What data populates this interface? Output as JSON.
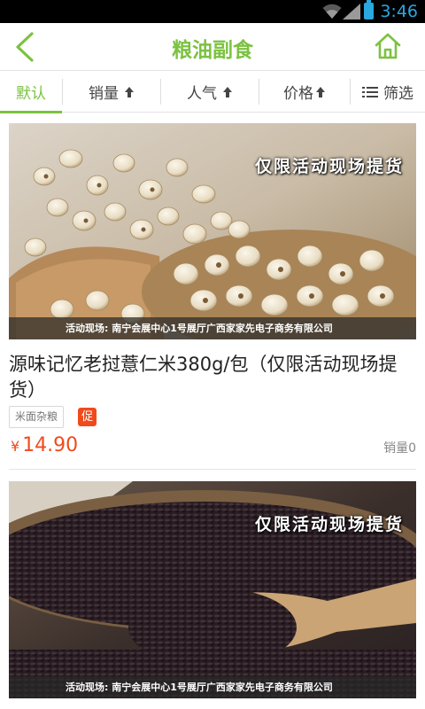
{
  "status_bar": {
    "time": "3:46"
  },
  "header": {
    "title": "粮油副食"
  },
  "sort_bar": {
    "items": [
      {
        "label": "默认"
      },
      {
        "label": "销量"
      },
      {
        "label": "人气"
      },
      {
        "label": "价格"
      },
      {
        "label": "筛选"
      }
    ]
  },
  "products": [
    {
      "promo_banner": "仅限活动现场提货",
      "venue_label": "活动现场:",
      "venue_text": "南宁会展中心1号展厅广西家家先电子商务有限公司",
      "name": "源味记忆老挝薏仁米380g/包（仅限活动现场提货）",
      "category": "米面杂粮",
      "badge": "促",
      "currency": "¥",
      "price": "14.90",
      "sales": "销量0"
    },
    {
      "promo_banner": "仅限活动现场提货",
      "venue_label": "活动现场:",
      "venue_text": "南宁会展中心1号展厅广西家家先电子商务有限公司"
    }
  ],
  "colors": {
    "accent": "#7cc241",
    "price": "#f04a1c",
    "status_time": "#2aa8e0"
  }
}
